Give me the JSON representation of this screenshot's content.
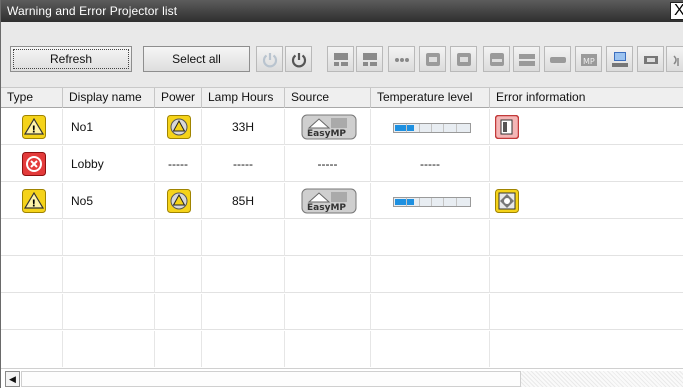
{
  "window": {
    "title": "Warning and Error Projector list",
    "close_glyph": "X"
  },
  "toolbar": {
    "refresh_label": "Refresh",
    "select_all_label": "Select all",
    "icons": [
      "power-off-icon",
      "power-on-icon",
      "computer-source-icon",
      "computer2-source-icon",
      "usb-display-icon",
      "s-video-source-icon",
      "video-source-icon",
      "hdmi-source-icon",
      "dvi-source-icon",
      "lan-source-icon",
      "mp-source-icon",
      "computer-network-icon",
      "easymp-icon",
      "wireless-icon"
    ]
  },
  "columns": [
    "Type",
    "Display name",
    "Power",
    "Lamp Hours",
    "Source",
    "Temperature level",
    "Error information"
  ],
  "rows": [
    {
      "type": "warning",
      "display_name": "No1",
      "power": "warning",
      "lamp_hours": "33H",
      "source": "EasyMP",
      "temperature_fraction": 0.25,
      "error_info": "lamp-cover-error"
    },
    {
      "type": "error",
      "display_name": "Lobby",
      "power": "-----",
      "lamp_hours": "-----",
      "source": "-----",
      "temperature_text": "-----",
      "error_info": ""
    },
    {
      "type": "warning",
      "display_name": "No5",
      "power": "warning",
      "lamp_hours": "85H",
      "source": "EasyMP",
      "temperature_fraction": 0.25,
      "error_info": "air-filter-warning"
    }
  ],
  "colors": {
    "warning_yellow": "#f5d31a",
    "error_red": "#e33b3b",
    "temp_fill": "#1e90e0",
    "title_bar": "#3a3a3a"
  }
}
